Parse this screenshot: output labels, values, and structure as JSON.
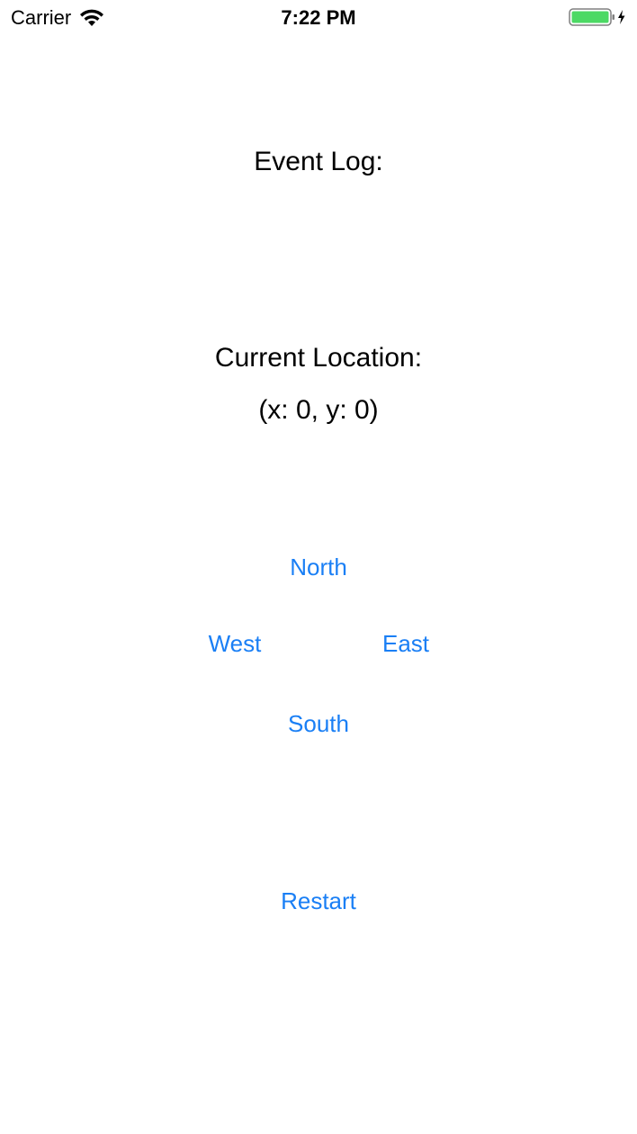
{
  "status_bar": {
    "carrier": "Carrier",
    "time": "7:22 PM",
    "battery_color": "#4cd964"
  },
  "labels": {
    "event_log": "Event Log:",
    "current_location": "Current Location:",
    "location_value": "(x: 0, y: 0)"
  },
  "buttons": {
    "north": "North",
    "west": "West",
    "east": "East",
    "south": "South",
    "restart": "Restart"
  },
  "colors": {
    "button_tint": "#1a7ff5",
    "text": "#000000",
    "background": "#ffffff"
  }
}
